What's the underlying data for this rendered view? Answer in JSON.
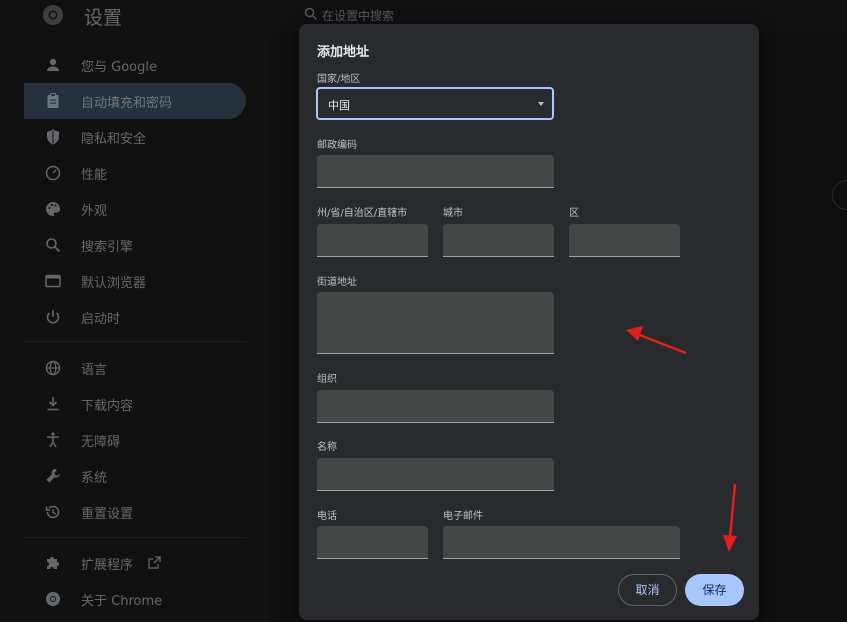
{
  "header": {
    "title": "设置",
    "search_placeholder": "在设置中搜索"
  },
  "sidebar": {
    "items": [
      {
        "label": "您与 Google",
        "icon": "person-icon"
      },
      {
        "label": "自动填充和密码",
        "icon": "clipboard-icon",
        "active": true
      },
      {
        "label": "隐私和安全",
        "icon": "shield-icon"
      },
      {
        "label": "性能",
        "icon": "speedometer-icon"
      },
      {
        "label": "外观",
        "icon": "palette-icon"
      },
      {
        "label": "搜索引擎",
        "icon": "search-icon"
      },
      {
        "label": "默认浏览器",
        "icon": "browser-icon"
      },
      {
        "label": "启动时",
        "icon": "power-icon"
      },
      {
        "label": "语言",
        "icon": "globe-icon"
      },
      {
        "label": "下载内容",
        "icon": "download-icon"
      },
      {
        "label": "无障碍",
        "icon": "accessibility-icon"
      },
      {
        "label": "系统",
        "icon": "wrench-icon"
      },
      {
        "label": "重置设置",
        "icon": "history-icon"
      },
      {
        "label": "扩展程序",
        "icon": "puzzle-icon"
      },
      {
        "label": "关于 Chrome",
        "icon": "chrome-icon"
      }
    ],
    "external_link_icon": "external-link-icon"
  },
  "dialog": {
    "title": "添加地址",
    "country_label": "国家/地区",
    "country_value": "中国",
    "postal_label": "邮政编码",
    "state_label": "州/省/自治区/直辖市",
    "city_label": "城市",
    "district_label": "区",
    "street_label": "街道地址",
    "org_label": "组织",
    "name_label": "名称",
    "phone_label": "电话",
    "email_label": "电子邮件",
    "cancel_label": "取消",
    "save_label": "保存"
  },
  "colors": {
    "accent": "#a8c7fa",
    "annotation_arrow": "#e0201b",
    "dialog_bg": "#292a2d",
    "field_bg": "#454646"
  }
}
